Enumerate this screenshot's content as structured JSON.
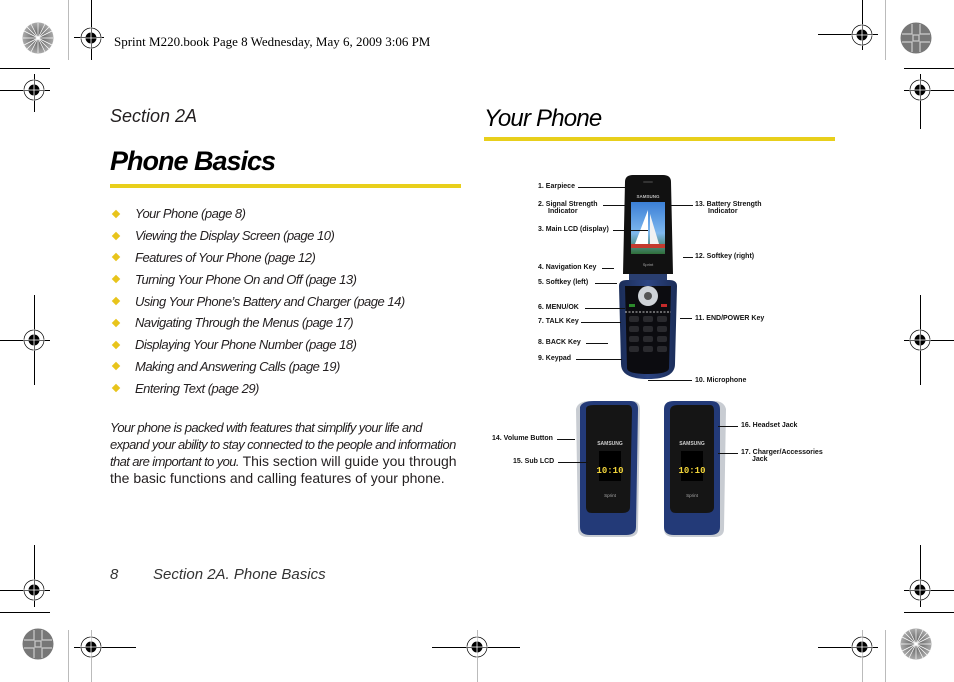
{
  "slug_line": "Sprint M220.book  Page 8  Wednesday, May 6, 2009  3:06 PM",
  "left_column": {
    "section_label": "Section 2A",
    "title": "Phone Basics",
    "toc_items": [
      "Your Phone (page 8)",
      "Viewing the Display Screen (page 10)",
      "Features of Your Phone (page 12)",
      "Turning Your Phone On and Off (page 13)",
      "Using Your Phone’s Battery and Charger (page 14)",
      "Navigating Through the Menus (page 17)",
      "Displaying Your Phone Number (page 18)",
      "Making and Answering Calls (page 19)",
      "Entering Text (page 29)"
    ],
    "intro_lead": "Your phone is packed with features that simplify your life and expand your ability to stay connected to the people and information that are important to you.",
    "intro_body": " This section will guide you through the basic functions and calling features of your phone."
  },
  "right_column": {
    "title": "Your Phone",
    "callouts": {
      "c1": "1. Earpiece",
      "c2a": "2. Signal Strength",
      "c2b": "Indicator",
      "c3": "3. Main LCD (display)",
      "c4": "4. Navigation Key",
      "c5": "5. Softkey (left)",
      "c6": "6. MENU/OK",
      "c7": "7. TALK Key",
      "c8": "8. BACK Key",
      "c9": "9. Keypad",
      "c10": "10. Microphone",
      "c11": "11. END/POWER Key",
      "c12": "12. Softkey (right)",
      "c13a": "13. Battery Strength",
      "c13b": "Indicator",
      "c14": "14. Volume Button",
      "c15": "15. Sub LCD",
      "c16": "16. Headset Jack",
      "c17a": "17. Charger/Accessories",
      "c17b": "Jack"
    },
    "phone_brand": "SAMSUNG",
    "carrier": "Sprint",
    "sub_lcd_time": "10:10"
  },
  "footer": {
    "page_number": "8",
    "running_title": "Section 2A. Phone Basics"
  },
  "colors": {
    "accent_yellow": "#e8cf1b",
    "bullet_yellow": "#e8c41b",
    "phone_blue": "#1f3566"
  }
}
